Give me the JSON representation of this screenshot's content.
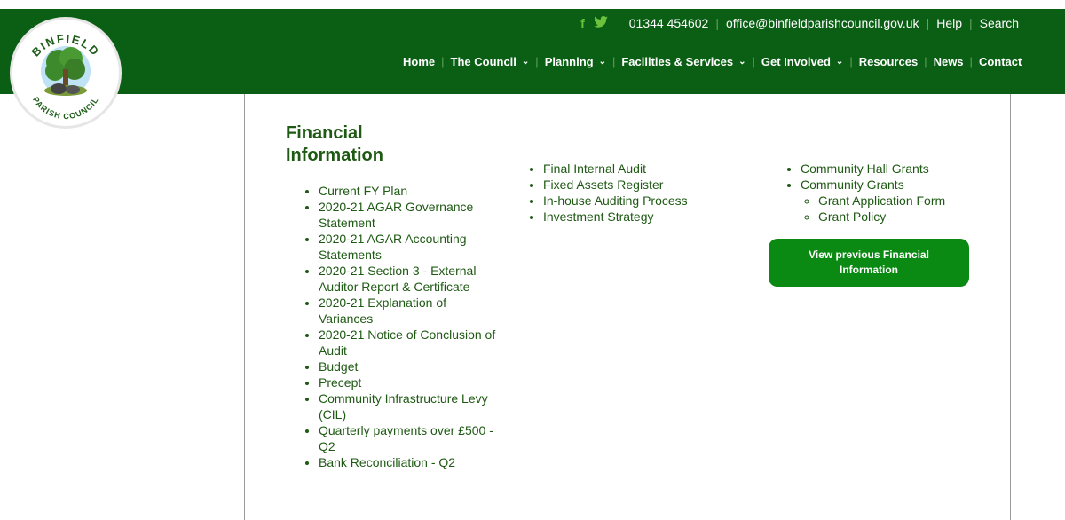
{
  "header": {
    "phone": "01344 454602",
    "email": "office@binfieldparishcouncil.gov.uk",
    "help": "Help",
    "search": "Search",
    "social_icons": [
      "facebook-icon",
      "twitter-icon"
    ]
  },
  "logo": {
    "top_text": "BINFIELD",
    "bottom_text": "PARISH COUNCIL"
  },
  "nav": {
    "home": "Home",
    "council": "The Council",
    "planning": "Planning",
    "facilities": "Facilities & Services",
    "involved": "Get Involved",
    "resources": "Resources",
    "news": "News",
    "contact": "Contact"
  },
  "content": {
    "title": "Financial Information",
    "col1": [
      "Current FY Plan",
      "2020-21 AGAR Governance Statement",
      "2020-21 AGAR Accounting Statements",
      "2020-21 Section 3 - External Auditor Report & Certificate",
      "2020-21 Explanation of Variances",
      "2020-21 Notice of Conclusion of Audit",
      "Budget",
      "Precept",
      "Community Infrastructure Levy (CIL)",
      "Quarterly payments over £500 - Q2",
      "Bank Reconciliation - Q2"
    ],
    "col2": [
      "Final Internal Audit",
      "Fixed Assets Register",
      "In-house Auditing Process",
      "Investment Strategy"
    ],
    "col3": {
      "community_hall_grants": "Community Hall Grants",
      "community_grants": "Community Grants",
      "grant_application_form": "Grant Application Form",
      "grant_policy": "Grant Policy"
    },
    "view_button": "View previous Financial Information"
  },
  "colors": {
    "header_green": "#0b5f14",
    "link_green": "#1f5a14",
    "button_green": "#0a8a12",
    "social_green": "#6bc23b"
  }
}
